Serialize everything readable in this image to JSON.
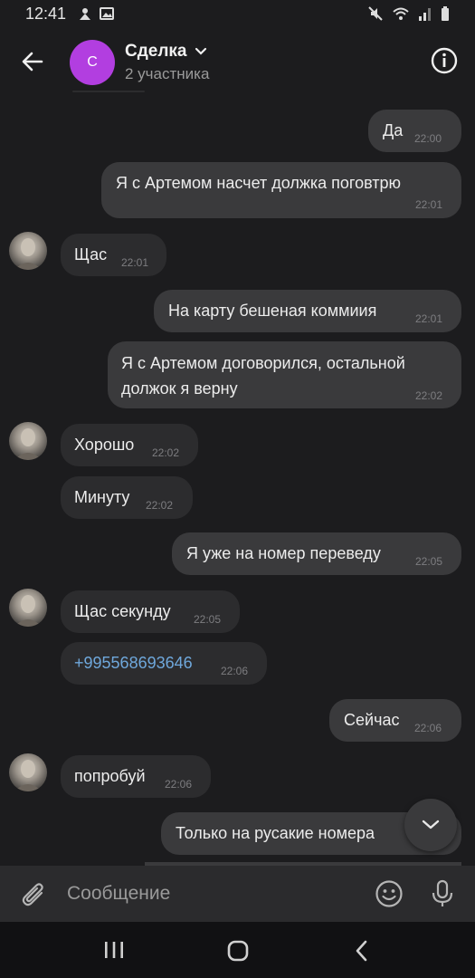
{
  "status_bar": {
    "time": "12:41"
  },
  "header": {
    "avatar_letter": "С",
    "title": "Сделка",
    "subtitle": "2 участника"
  },
  "messages": [
    {
      "side": "out",
      "text": "Да",
      "time": "22:00"
    },
    {
      "side": "out",
      "text": "Я с Артемом насчет должка поговтрю",
      "time": "22:01"
    },
    {
      "side": "in",
      "text": "Щас",
      "time": "22:01"
    },
    {
      "side": "out",
      "text": "На карту бешеная коммиия",
      "time": "22:01"
    },
    {
      "side": "out",
      "text_line1": "Я с Артемом договорился, остальной",
      "text_line2": "должок я верну",
      "time": "22:02"
    },
    {
      "side": "in",
      "text": "Хорошо",
      "time": "22:02"
    },
    {
      "side": "in",
      "text": "Минуту",
      "time": "22:02"
    },
    {
      "side": "out",
      "text": "Я уже на номер переведу",
      "time": "22:05"
    },
    {
      "side": "in",
      "text": "Щас секунду",
      "time": "22:05"
    },
    {
      "side": "in",
      "text": "+995568693646",
      "time": "22:06"
    },
    {
      "side": "out",
      "text": "Сейчас",
      "time": "22:06"
    },
    {
      "side": "in",
      "text": "попробуй",
      "time": "22:06"
    },
    {
      "side": "out",
      "text": "Только на русакие номера",
      "time": ""
    }
  ],
  "composer": {
    "placeholder": "Сообщение"
  },
  "colors": {
    "background": "#1c1c1e",
    "bubble_out": "#3a3a3c",
    "bubble_in": "#2c2c2e",
    "avatar": "#b23ee0",
    "link": "#6fa8dc"
  },
  "icons": [
    "back-arrow-icon",
    "info-icon",
    "chevron-down-icon",
    "paperclip-icon",
    "emoji-icon",
    "mic-icon",
    "recent-apps-icon",
    "home-icon",
    "nav-back-icon",
    "scroll-down-icon"
  ]
}
